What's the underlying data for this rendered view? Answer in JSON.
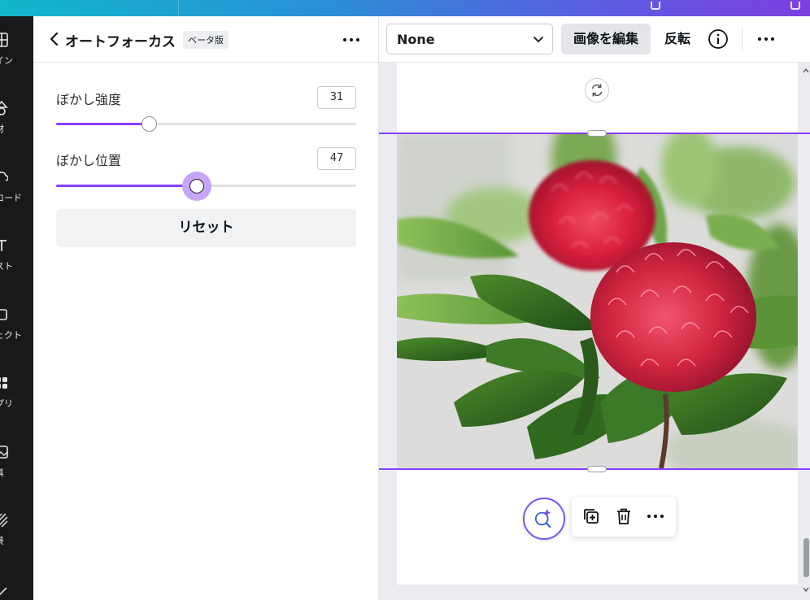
{
  "rail": {
    "items": [
      {
        "label": "イン",
        "icon": "design-icon"
      },
      {
        "label": "材",
        "icon": "elements-icon"
      },
      {
        "label": "ロード",
        "icon": "upload-icon"
      },
      {
        "label": "スト",
        "icon": "text-icon"
      },
      {
        "label": "ェクト",
        "icon": "projects-icon"
      },
      {
        "label": "プリ",
        "icon": "apps-icon"
      },
      {
        "label": "真",
        "icon": "photos-icon"
      },
      {
        "label": "景",
        "icon": "background-icon"
      }
    ]
  },
  "panel": {
    "title": "オートフォーカス",
    "badge": "ベータ版",
    "sliders": [
      {
        "label": "ぼかし強度",
        "value": "31",
        "percent": 31
      },
      {
        "label": "ぼかし位置",
        "value": "47",
        "percent": 47
      }
    ],
    "reset_label": "リセット"
  },
  "toolbar": {
    "select_value": "None",
    "edit_label": "画像を編集",
    "flip_label": "反転"
  },
  "colors": {
    "accent": "#8b3dff",
    "rail_bg": "#18191b"
  }
}
